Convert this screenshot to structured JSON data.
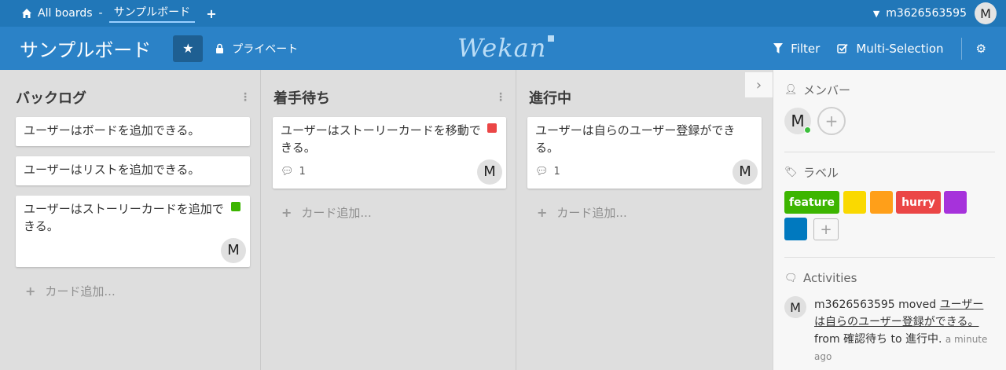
{
  "topbar": {
    "all_boards": "All boards",
    "separator": "-",
    "current_board": "サンプルボード",
    "add_icon": "plus-icon",
    "username": "m3626563595",
    "avatar_initial": "M"
  },
  "board": {
    "title": "サンプルボード",
    "visibility": "プライベート",
    "logo": "Wekan",
    "filter_label": "Filter",
    "multiselect_label": "Multi-Selection"
  },
  "lists": [
    {
      "title": "バックログ",
      "cards": [
        {
          "text": "ユーザーはボードを追加できる。"
        },
        {
          "text": "ユーザーはリストを追加できる。"
        },
        {
          "text": "ユーザーはストーリーカードを追加できる。",
          "label_color": "#3cb500",
          "member": "M"
        }
      ],
      "add_card": "カード追加..."
    },
    {
      "title": "着手待ち",
      "cards": [
        {
          "text": "ユーザーはストーリーカードを移動できる。",
          "label_color": "#eb4646",
          "comments": "1",
          "member": "M"
        }
      ],
      "add_card": "カード追加..."
    },
    {
      "title": "進行中",
      "cards": [
        {
          "text": "ユーザーは自らのユーザー登録ができる。",
          "comments": "1",
          "member": "M"
        }
      ],
      "add_card": "カード追加..."
    }
  ],
  "sidebar": {
    "members_title": "メンバー",
    "member_initial": "M",
    "labels_title": "ラベル",
    "labels": [
      {
        "name": "feature",
        "color": "#3cb500"
      },
      {
        "name": "",
        "color": "#fad900"
      },
      {
        "name": "",
        "color": "#ff9f19"
      },
      {
        "name": "hurry",
        "color": "#eb4646"
      },
      {
        "name": "",
        "color": "#a632db"
      },
      {
        "name": "",
        "color": "#0079bf"
      }
    ],
    "activities_title": "Activities",
    "activity": {
      "avatar": "M",
      "user": "m3626563595",
      "verb": " moved ",
      "card": "ユーザーは自らのユーザー登録ができる。",
      "from_text": " from 確認待ち to 進行中.",
      "time": "a minute ago"
    }
  }
}
